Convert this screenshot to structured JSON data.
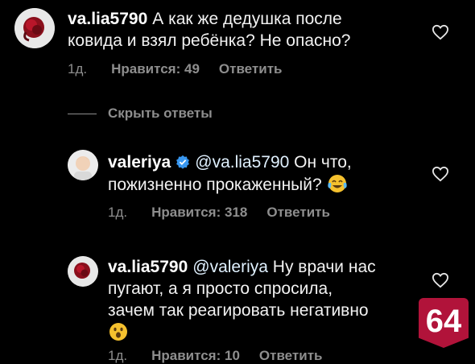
{
  "comments": [
    {
      "username": "va.lia5790",
      "text_lines": [
        "А как же дедушка после",
        "ковида и взял ребёнка? Не опасно?"
      ],
      "time": "1д.",
      "likes": "Нравится: 49",
      "reply": "Ответить"
    },
    {
      "username": "valeriya",
      "mention": "@va.lia5790",
      "text_line1": "Он что,",
      "text_line2": "пожизненно прокаженный?",
      "emoji": "face-with-tears-of-joy",
      "time": "1д.",
      "likes": "Нравится: 318",
      "reply": "Ответить"
    },
    {
      "username": "va.lia5790",
      "mention": "@valeriya",
      "text_line1": "Ну врачи нас",
      "text_line2": "пугают, а я просто спросила,",
      "text_line3": "зачем так реагировать негативно",
      "emoji": "face-with-open-mouth",
      "time": "1д.",
      "likes": "Нравится: 10",
      "reply": "Ответить"
    }
  ],
  "hide_replies": "Скрыть ответы",
  "badge": "64",
  "colors": {
    "background": "#000000",
    "text": "#f2f2f2",
    "muted": "#8e8e8e",
    "verified": "#3897f0",
    "badge": "#b1133a"
  }
}
